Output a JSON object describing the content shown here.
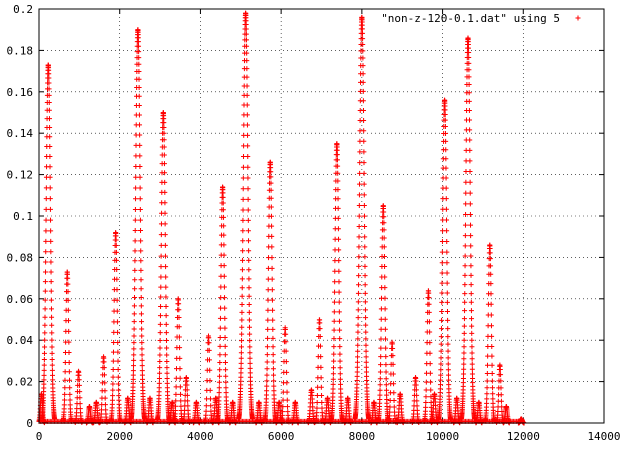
{
  "chart_data": {
    "type": "scatter",
    "title": "",
    "xlabel": "",
    "ylabel": "",
    "xlim": [
      0,
      14000
    ],
    "ylim": [
      0,
      0.2
    ],
    "xticks": [
      "0",
      "2000",
      "4000",
      "6000",
      "8000",
      "10000",
      "12000",
      "14000"
    ],
    "yticks": [
      "0",
      "0.02",
      "0.04",
      "0.06",
      "0.08",
      "0.1",
      "0.12",
      "0.14",
      "0.16",
      "0.18",
      "0.2"
    ],
    "grid": true,
    "legend_position": "top-right",
    "marker": "+",
    "series": [
      {
        "name": "\"non-z-120-0.1.dat\" using 5",
        "color": "#ff0000",
        "peaks": [
          {
            "x": 60,
            "y": 0.014
          },
          {
            "x": 230,
            "y": 0.173
          },
          {
            "x": 700,
            "y": 0.073
          },
          {
            "x": 980,
            "y": 0.025
          },
          {
            "x": 1250,
            "y": 0.008
          },
          {
            "x": 1420,
            "y": 0.01
          },
          {
            "x": 1600,
            "y": 0.032
          },
          {
            "x": 1900,
            "y": 0.092
          },
          {
            "x": 2200,
            "y": 0.012
          },
          {
            "x": 2450,
            "y": 0.19
          },
          {
            "x": 2750,
            "y": 0.012
          },
          {
            "x": 3080,
            "y": 0.15
          },
          {
            "x": 3300,
            "y": 0.01
          },
          {
            "x": 3450,
            "y": 0.06
          },
          {
            "x": 3650,
            "y": 0.022
          },
          {
            "x": 3900,
            "y": 0.01
          },
          {
            "x": 4200,
            "y": 0.042
          },
          {
            "x": 4380,
            "y": 0.012
          },
          {
            "x": 4550,
            "y": 0.114
          },
          {
            "x": 4800,
            "y": 0.01
          },
          {
            "x": 5120,
            "y": 0.198
          },
          {
            "x": 5450,
            "y": 0.01
          },
          {
            "x": 5730,
            "y": 0.126
          },
          {
            "x": 5950,
            "y": 0.01
          },
          {
            "x": 6100,
            "y": 0.046
          },
          {
            "x": 6350,
            "y": 0.01
          },
          {
            "x": 6750,
            "y": 0.016
          },
          {
            "x": 6950,
            "y": 0.05
          },
          {
            "x": 7150,
            "y": 0.012
          },
          {
            "x": 7380,
            "y": 0.135
          },
          {
            "x": 7650,
            "y": 0.012
          },
          {
            "x": 8000,
            "y": 0.196
          },
          {
            "x": 8300,
            "y": 0.01
          },
          {
            "x": 8530,
            "y": 0.105
          },
          {
            "x": 8750,
            "y": 0.039
          },
          {
            "x": 8950,
            "y": 0.014
          },
          {
            "x": 9330,
            "y": 0.022
          },
          {
            "x": 9650,
            "y": 0.064
          },
          {
            "x": 9800,
            "y": 0.014
          },
          {
            "x": 10050,
            "y": 0.156
          },
          {
            "x": 10350,
            "y": 0.012
          },
          {
            "x": 10630,
            "y": 0.186
          },
          {
            "x": 10900,
            "y": 0.01
          },
          {
            "x": 11170,
            "y": 0.086
          },
          {
            "x": 11420,
            "y": 0.028
          },
          {
            "x": 11580,
            "y": 0.008
          },
          {
            "x": 11950,
            "y": 0.002
          }
        ]
      }
    ]
  }
}
